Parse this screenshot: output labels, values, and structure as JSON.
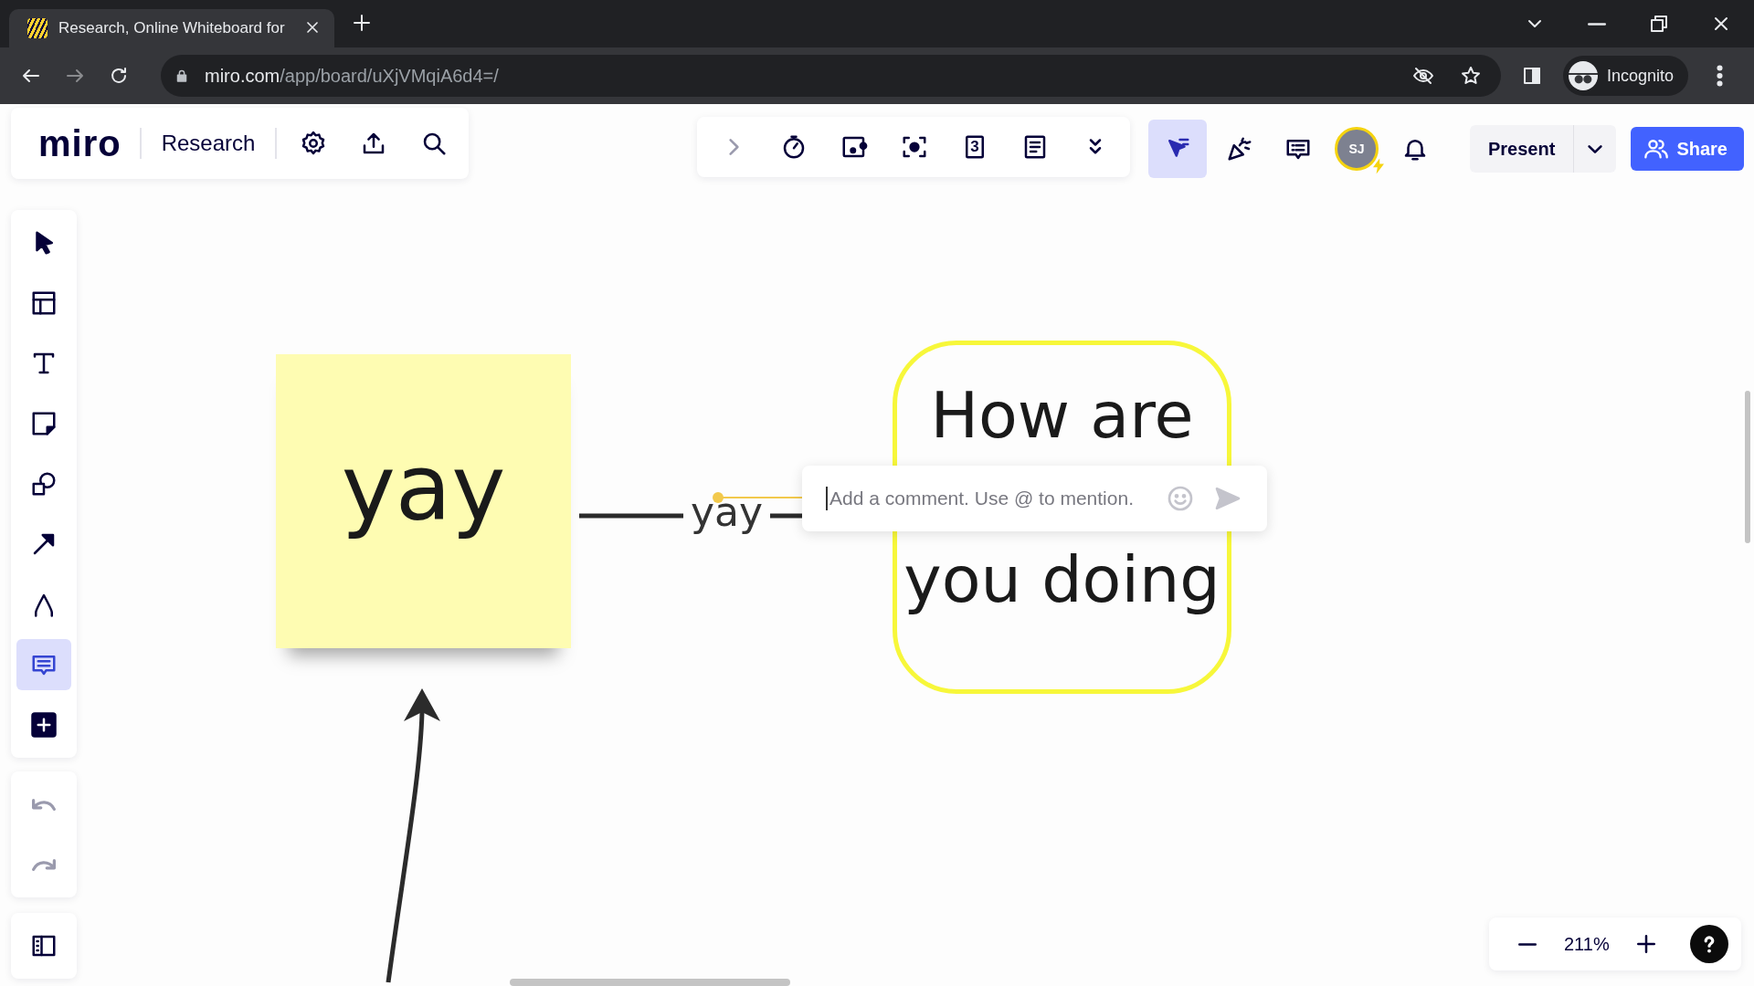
{
  "browser": {
    "tab": {
      "title": "Research, Online Whiteboard for"
    },
    "url": {
      "host": "miro.com",
      "path": "/app/board/uXjVMqiA6d4=/"
    },
    "profile": "Incognito"
  },
  "header": {
    "logo": "miro",
    "board_title": "Research",
    "board_tools": [
      {
        "kind": "settings"
      },
      {
        "kind": "export"
      },
      {
        "kind": "search"
      }
    ],
    "apps": [
      {
        "kind": "expand"
      },
      {
        "kind": "timer"
      },
      {
        "kind": "card"
      },
      {
        "kind": "focus"
      },
      {
        "kind": "counter",
        "text": "3"
      },
      {
        "kind": "notes"
      },
      {
        "kind": "more"
      }
    ],
    "collab": [
      {
        "kind": "cursor",
        "selected": true
      },
      {
        "kind": "reactions",
        "selected": false
      },
      {
        "kind": "comments",
        "selected": false
      }
    ],
    "avatar": "SJ",
    "present": "Present",
    "share": "Share"
  },
  "left_toolbar": [
    {
      "kind": "select",
      "selected": false
    },
    {
      "kind": "frame",
      "selected": false
    },
    {
      "kind": "text",
      "selected": false
    },
    {
      "kind": "sticky",
      "selected": false
    },
    {
      "kind": "shapes",
      "selected": false
    },
    {
      "kind": "line",
      "selected": false
    },
    {
      "kind": "pen",
      "selected": false
    },
    {
      "kind": "comment",
      "selected": true
    },
    {
      "kind": "add",
      "selected": false
    }
  ],
  "canvas": {
    "sticky": {
      "text": "yay"
    },
    "connector": {
      "label": "yay"
    },
    "shape": {
      "lines": [
        "How are",
        "you doing"
      ]
    },
    "comment": {
      "placeholder": "Add a comment. Use @ to mention."
    }
  },
  "zoom": {
    "reading": "211%"
  }
}
